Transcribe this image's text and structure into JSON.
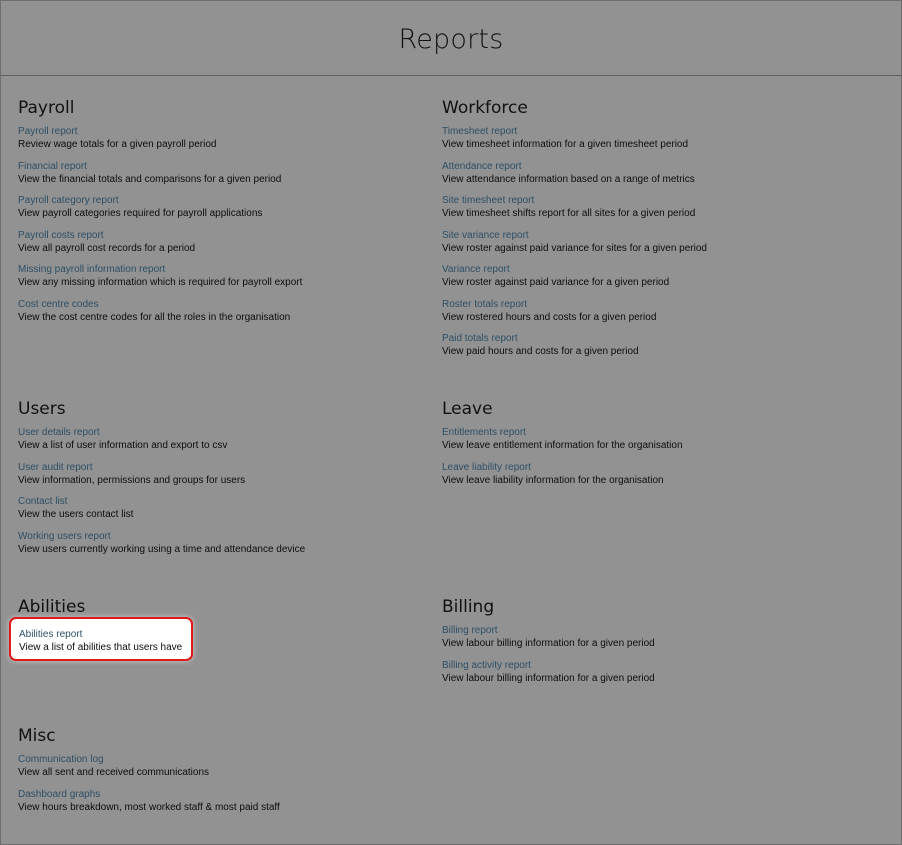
{
  "page": {
    "title": "Reports"
  },
  "sections": {
    "payroll": {
      "title": "Payroll",
      "items": [
        {
          "label": "Payroll report",
          "desc": "Review wage totals for a given payroll period"
        },
        {
          "label": "Financial report",
          "desc": "View the financial totals and comparisons for a given period"
        },
        {
          "label": "Payroll category report",
          "desc": "View payroll categories required for payroll applications"
        },
        {
          "label": "Payroll costs report",
          "desc": "View all payroll cost records for a period"
        },
        {
          "label": "Missing payroll information report",
          "desc": "View any missing information which is required for payroll export"
        },
        {
          "label": "Cost centre codes",
          "desc": "View the cost centre codes for all the roles in the organisation"
        }
      ]
    },
    "workforce": {
      "title": "Workforce",
      "items": [
        {
          "label": "Timesheet report",
          "desc": "View timesheet information for a given timesheet period"
        },
        {
          "label": "Attendance report",
          "desc": "View attendance information based on a range of metrics"
        },
        {
          "label": "Site timesheet report",
          "desc": "View timesheet shifts report for all sites for a given period"
        },
        {
          "label": "Site variance report",
          "desc": "View roster against paid variance for sites for a given period"
        },
        {
          "label": "Variance report",
          "desc": "View roster against paid variance for a given period"
        },
        {
          "label": "Roster totals report",
          "desc": "View rostered hours and costs for a given period"
        },
        {
          "label": "Paid totals report",
          "desc": "View paid hours and costs for a given period"
        }
      ]
    },
    "users": {
      "title": "Users",
      "items": [
        {
          "label": "User details report",
          "desc": "View a list of user information and export to csv"
        },
        {
          "label": "User audit report",
          "desc": "View information, permissions and groups for users"
        },
        {
          "label": "Contact list",
          "desc": "View the users contact list"
        },
        {
          "label": "Working users report",
          "desc": "View users currently working using a time and attendance device"
        }
      ]
    },
    "leave": {
      "title": "Leave",
      "items": [
        {
          "label": "Entitlements report",
          "desc": "View leave entitlement information for the organisation"
        },
        {
          "label": "Leave liability report",
          "desc": "View leave liability information for the organisation"
        }
      ]
    },
    "abilities": {
      "title": "Abilities",
      "items": [
        {
          "label": "Abilities report",
          "desc": "View a list of abilities that users have"
        }
      ]
    },
    "billing": {
      "title": "Billing",
      "items": [
        {
          "label": "Billing report",
          "desc": "View labour billing information for a given period"
        },
        {
          "label": "Billing activity report",
          "desc": "View labour billing information for a given period"
        }
      ]
    },
    "misc": {
      "title": "Misc",
      "items": [
        {
          "label": "Communication log",
          "desc": "View all sent and received communications"
        },
        {
          "label": "Dashboard graphs",
          "desc": "View hours breakdown, most worked staff & most paid staff"
        }
      ]
    }
  }
}
